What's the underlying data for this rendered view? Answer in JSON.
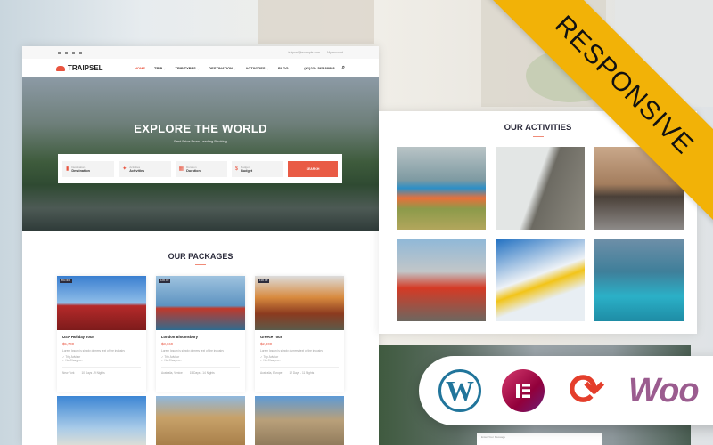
{
  "site": {
    "logo": "TRAIPSEL",
    "topbar": {
      "email": "traipsel@example.com",
      "account": "My account",
      "social": [
        "facebook-icon",
        "twitter-icon",
        "youtube-icon",
        "instagram-icon"
      ]
    },
    "nav": [
      "HOME",
      "TRIP ⌄",
      "TRIP TYPES ⌄",
      "DESTINATION ⌄",
      "ACTIVITIES ⌄",
      "BLOG"
    ],
    "phone": "(+1)234-565-88888",
    "accent": "#e9543f"
  },
  "hero": {
    "title": "EXPLORE THE WORLD",
    "subtitle": "Best Price From Leading Booking",
    "fields": [
      {
        "label": "Destination",
        "value": "Destination",
        "icon": "map-icon"
      },
      {
        "label": "Activities",
        "value": "Activities",
        "icon": "person-icon"
      },
      {
        "label": "Duration",
        "value": "Duration",
        "icon": "calendar-icon"
      },
      {
        "label": "Budget",
        "value": "Budget",
        "icon": "dollar-icon"
      }
    ],
    "search_label": "SEARCH"
  },
  "packages": {
    "title": "OUR PACKAGES",
    "items": [
      {
        "badge": "8% OFF",
        "title": "USA Holiday Tour",
        "price": "$5,700",
        "desc": "Lorem Ipsum is simply dummy text of the industry",
        "features": [
          "✓ Trip Advisor",
          "✓ No Charges..."
        ],
        "location": "New York",
        "duration": "10 Days - 9 Nights"
      },
      {
        "badge": "12% Off",
        "title": "London Bloomsbury",
        "price": "$3,669",
        "desc": "Lorem Ipsum is simply dummy text of the industry",
        "features": [
          "✓ Trip Advisor",
          "✓ No Charges..."
        ],
        "location": "Australia, Venice",
        "duration": "15 Days - 14 Nights"
      },
      {
        "badge": "13% Off",
        "title": "Greece Tour",
        "price": "$2,900",
        "desc": "Lorem Ipsum is simply dummy text of the industry",
        "features": [
          "✓ Trip Advisor",
          "✓ No Charges..."
        ],
        "location": "Australia, Europe",
        "duration": "12 Days - 11 Nights"
      }
    ]
  },
  "activities": {
    "title": "OUR ACTIVITIES"
  },
  "contact": {
    "message_placeholder": "Enter Your Message"
  },
  "ribbon": {
    "text": "RESPONSIVE",
    "color": "#f2b207"
  },
  "badges": {
    "woo": "Woo",
    "icons": [
      "wordpress-icon",
      "elementor-icon",
      "sync-icon",
      "woocommerce-icon"
    ]
  }
}
